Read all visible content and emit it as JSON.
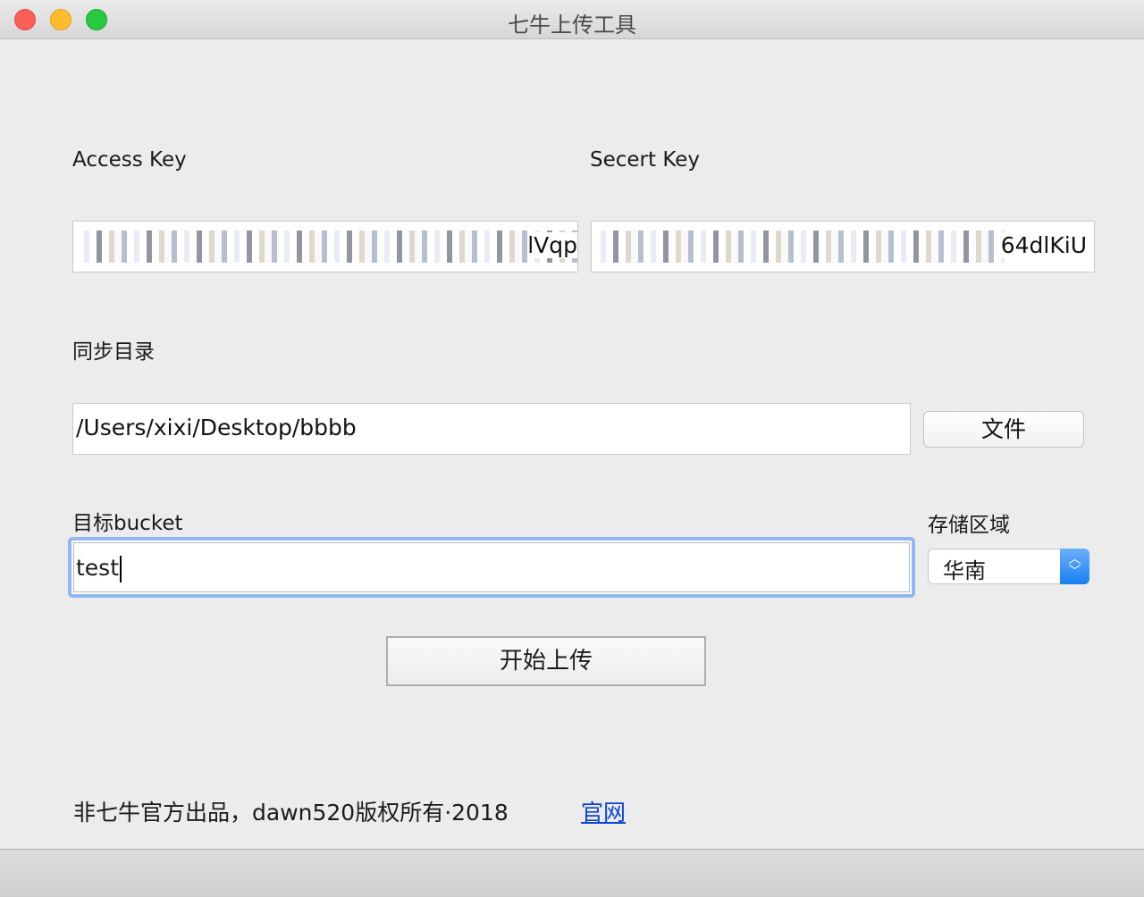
{
  "window": {
    "title": "七牛上传工具"
  },
  "access_key": {
    "label": "Access Key",
    "visible_tail": "lVqp"
  },
  "secret_key": {
    "label": "Secert Key",
    "visible_tail": "64dlKiU"
  },
  "sync_dir": {
    "label": "同步目录",
    "value": "/Users/xixi/Desktop/bbbb",
    "browse_button": "文件"
  },
  "bucket": {
    "label": "目标bucket",
    "value": "test"
  },
  "region": {
    "label": "存储区域",
    "selected": "华南"
  },
  "upload_button": "开始上传",
  "footer": {
    "copyright": "非七牛官方出品，dawn520版权所有·2018",
    "link": "官网"
  }
}
